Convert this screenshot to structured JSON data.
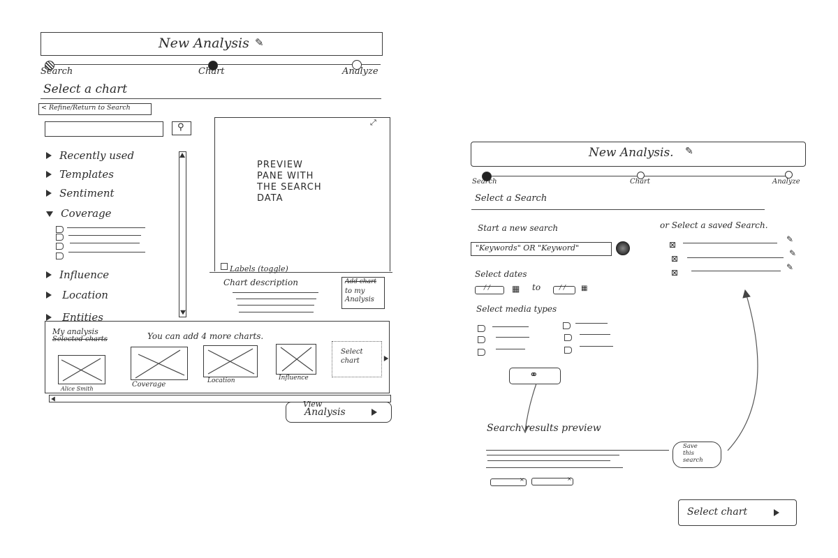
{
  "left_sketch": {
    "title": "New Analysis",
    "title_edit_icon": "pencil-icon",
    "steps": [
      {
        "label": "Search",
        "state": "completed"
      },
      {
        "label": "Chart",
        "state": "current"
      },
      {
        "label": "Analyze",
        "state": "upcoming"
      }
    ],
    "heading": "Select a chart",
    "back_button": "< Refine/Return to Search",
    "search": {
      "value": "",
      "button_icon": "search-icon"
    },
    "categories": [
      {
        "label": "Recently used",
        "expanded": false
      },
      {
        "label": "Templates",
        "expanded": false
      },
      {
        "label": "Sentiment",
        "expanded": false
      },
      {
        "label": "Coverage",
        "expanded": true,
        "children": [
          "",
          "",
          "",
          ""
        ]
      },
      {
        "label": "Influence",
        "expanded": false
      },
      {
        "label": "Location",
        "expanded": false
      },
      {
        "label": "Entities",
        "expanded": false
      }
    ],
    "preview": {
      "text_lines": [
        "PREVIEW",
        "PANE WITH",
        "THE SEARCH",
        "DATA"
      ],
      "expand_icon": "expand-icon",
      "labels_toggle": "Labels (toggle)"
    },
    "chart_description": {
      "heading": "Chart description",
      "lines": [
        "",
        "",
        "",
        ""
      ]
    },
    "add_button": {
      "struck_text": "Add chart",
      "label": "to my Analysis"
    },
    "my_analysis": {
      "heading": "My analysis",
      "struck_heading": "Selected charts",
      "hint": "You can add 4 more charts.",
      "charts": [
        {
          "label": "Alice Smith"
        },
        {
          "label": "Coverage"
        },
        {
          "label": "Location"
        },
        {
          "label": "Influence"
        }
      ],
      "placeholder": "Select chart"
    },
    "view_button": {
      "line1": "View",
      "line2": "Analysis"
    }
  },
  "right_sketch": {
    "title": "New Analysis.",
    "title_edit_icon": "pencil-icon",
    "steps": [
      {
        "label": "Search",
        "state": "current"
      },
      {
        "label": "Chart",
        "state": "upcoming"
      },
      {
        "label": "Analyze",
        "state": "upcoming"
      }
    ],
    "heading": "Select a Search",
    "new_search": {
      "label": "Start a new search",
      "value": "\"Keywords\" OR \"Keyword\"",
      "globe_icon": "globe-icon"
    },
    "saved_search": {
      "label": "or Select a saved Search.",
      "items": [
        "",
        "",
        ""
      ]
    },
    "dates": {
      "label": "Select dates",
      "from": "/ /",
      "to_label": "to",
      "to": "/ /"
    },
    "media_types": {
      "label": "Select media types",
      "col1": [
        "",
        "",
        ""
      ],
      "col2": [
        "",
        "",
        ""
      ]
    },
    "search_button_icon": "binoculars-icon",
    "results": {
      "heading": "Search results preview",
      "lines": [
        "",
        "",
        "",
        ""
      ],
      "filters": [
        "",
        ""
      ]
    },
    "save_button": {
      "lines": [
        "Save",
        "this",
        "search"
      ]
    },
    "select_chart_button": "Select chart"
  }
}
